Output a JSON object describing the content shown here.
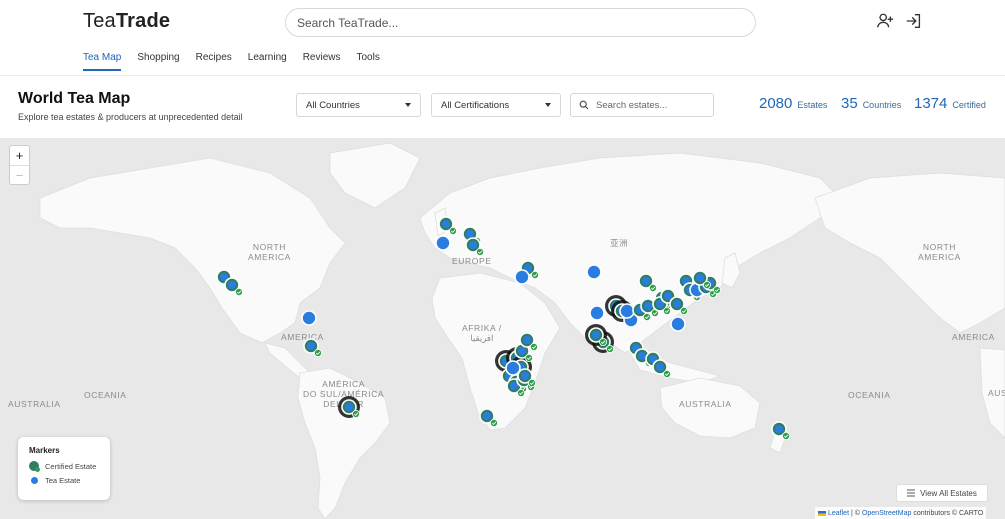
{
  "header": {
    "logo_light": "Tea",
    "logo_bold": "Trade",
    "search_placeholder": "Search TeaTrade...",
    "icons": [
      "add-user-icon",
      "sign-in-icon"
    ]
  },
  "nav": {
    "tabs": [
      {
        "label": "Tea Map",
        "active": true
      },
      {
        "label": "Shopping",
        "active": false
      },
      {
        "label": "Recipes",
        "active": false
      },
      {
        "label": "Learning",
        "active": false
      },
      {
        "label": "Reviews",
        "active": false
      },
      {
        "label": "Tools",
        "active": false
      }
    ]
  },
  "page": {
    "title": "World Tea Map",
    "subtitle": "Explore tea estates & producers at unprecedented detail"
  },
  "filters": {
    "countries": "All Countries",
    "certifications": "All Certifications",
    "estate_search_placeholder": "Search estates..."
  },
  "stats": {
    "estates_value": "2080",
    "estates_label": "Estates",
    "countries_value": "35",
    "countries_label": "Countries",
    "certified_value": "1374",
    "certified_label": "Certified"
  },
  "map": {
    "zoom_in": "+",
    "zoom_out": "−",
    "labels": {
      "north_america_left": "NORTH\nAMERICA",
      "north_america_right": "NORTH\nAMERICA",
      "europe": "EUROPE",
      "asia": "亚洲",
      "africa": "AFRIKA /\nافريقيا",
      "america_left": "AMERICA",
      "america_right": "AMERICA",
      "south_america": "AMÉRICA\nDO SUL/AMÉRICA\nDEL SUR",
      "oceania_left": "OCEANIA",
      "oceania_right": "OCEANIA",
      "australia_left": "AUSTRALIA",
      "australia_center": "AUSTRALIA",
      "australia_right": "AUSTRALIA"
    },
    "legend": {
      "title": "Markers",
      "certified": "Certified Estate",
      "tea": "Tea Estate"
    },
    "view_all": "View All Estates",
    "attribution": {
      "leaflet": "Leaflet",
      "sep1": "| ©",
      "osm": "OpenStreetMap",
      "rest": "contributors © CARTO"
    }
  },
  "colors": {
    "accent": "#2166b7",
    "tea_marker": "#2a7de0",
    "certified_marker": "#2f7e63",
    "check": "#2e9e4a",
    "land": "#fafafa",
    "water": "#e6e6e6"
  }
}
